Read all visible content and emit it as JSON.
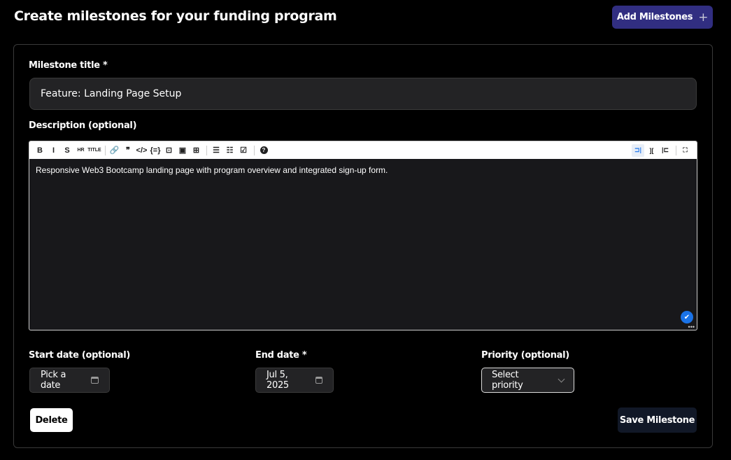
{
  "page_title": "Create milestones for your funding program",
  "add_button": {
    "label": "Add Milestones",
    "icon": "plus-icon"
  },
  "form": {
    "title_label": "Milestone title *",
    "title_value": "Feature: Landing Page Setup",
    "description_label": "Description (optional)",
    "description_value": "Responsive Web3 Bootcamp landing page with program overview and integrated sign-up form.",
    "toolbar": [
      {
        "name": "bold",
        "glyph": "B"
      },
      {
        "name": "italic",
        "glyph": "I"
      },
      {
        "name": "strikethrough",
        "glyph": "S"
      },
      {
        "name": "hr",
        "glyph": "HR"
      },
      {
        "name": "title",
        "glyph": "TITLE"
      },
      {
        "name": "link",
        "glyph": "🔗"
      },
      {
        "name": "quote",
        "glyph": "❞"
      },
      {
        "name": "code",
        "glyph": "</>"
      },
      {
        "name": "code-block",
        "glyph": "{=}"
      },
      {
        "name": "comment",
        "glyph": "⊡"
      },
      {
        "name": "image",
        "glyph": "▣"
      },
      {
        "name": "table",
        "glyph": "⊞"
      },
      {
        "name": "unordered-list",
        "glyph": "☰"
      },
      {
        "name": "ordered-list",
        "glyph": "☷"
      },
      {
        "name": "checked-list",
        "glyph": "☑"
      },
      {
        "name": "help",
        "glyph": "?"
      }
    ],
    "toolbar_right": [
      {
        "name": "edit-mode",
        "glyph": "⊐|"
      },
      {
        "name": "live-mode",
        "glyph": "]["
      },
      {
        "name": "preview-mode",
        "glyph": "|⊏"
      },
      {
        "name": "fullscreen",
        "glyph": "⛶"
      }
    ],
    "start_date_label": "Start date (optional)",
    "start_date_value": "Pick a date",
    "end_date_label": "End date *",
    "end_date_value": "Jul 5, 2025",
    "priority_label": "Priority (optional)",
    "priority_value": "Select priority",
    "delete_label": "Delete",
    "save_label": "Save Milestone"
  }
}
